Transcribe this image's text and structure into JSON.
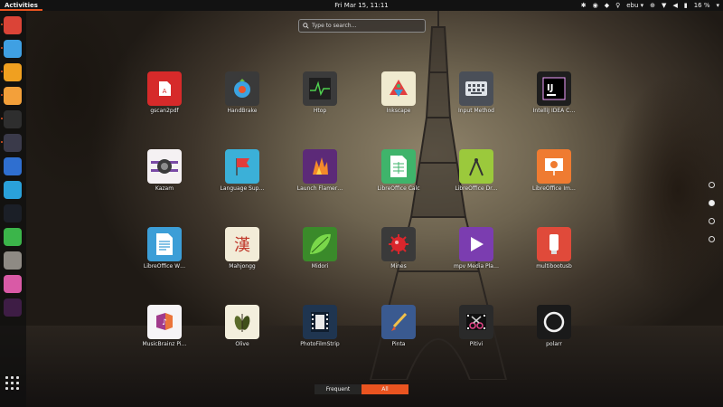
{
  "topbar": {
    "activities": "Activities",
    "clock": "Fri Mar 15, 11:11",
    "user": "ebu",
    "battery": "16 %"
  },
  "search": {
    "placeholder": "Type to search…"
  },
  "dock": [
    {
      "name": "chrome",
      "color": "#db4437"
    },
    {
      "name": "firefox",
      "color": "#3fa0e3"
    },
    {
      "name": "mail",
      "color": "#f0a020"
    },
    {
      "name": "screenshot",
      "color": "#f3a03a"
    },
    {
      "name": "terminal",
      "color": "#2e2e2e"
    },
    {
      "name": "obs",
      "color": "#3a3a4a"
    },
    {
      "name": "virtualbox",
      "color": "#2f6fd0"
    },
    {
      "name": "telegram",
      "color": "#2aa1da"
    },
    {
      "name": "steam",
      "color": "#1b1f27"
    },
    {
      "name": "downloader",
      "color": "#3bb54a"
    },
    {
      "name": "archiver",
      "color": "#8e8a84"
    },
    {
      "name": "headset",
      "color": "#d95aa6"
    },
    {
      "name": "slack",
      "color": "#3e1d45"
    }
  ],
  "apps": [
    {
      "label": "gscan2pdf",
      "color": "#d62a2a",
      "icon": "pdf-icon"
    },
    {
      "label": "HandBrake",
      "color": "#3a3a3a",
      "icon": "pineapple-icon"
    },
    {
      "label": "Htop",
      "color": "#3b3b3b",
      "icon": "pulse-icon"
    },
    {
      "label": "Inkscape",
      "color": "#f0eacf",
      "icon": "inkscape-icon"
    },
    {
      "label": "Input Method",
      "color": "#4a4f58",
      "icon": "keyboard-icon"
    },
    {
      "label": "IntelliJ IDEA C…",
      "color": "#1e1e1e",
      "icon": "intellij-icon"
    },
    {
      "label": "Kazam",
      "color": "#f5f1f3",
      "icon": "camera-icon"
    },
    {
      "label": "Language Sup…",
      "color": "#3bb0d8",
      "icon": "flag-icon"
    },
    {
      "label": "Launch Flamer…",
      "color": "#5c2a78",
      "icon": "flame-icon"
    },
    {
      "label": "LibreOffice Calc",
      "color": "#3fb46b",
      "icon": "spreadsheet-icon"
    },
    {
      "label": "LibreOffice Dr…",
      "color": "#9bc93c",
      "icon": "compass-icon"
    },
    {
      "label": "LibreOffice Im…",
      "color": "#ef7b31",
      "icon": "presentation-icon"
    },
    {
      "label": "LibreOffice W…",
      "color": "#3c9ed7",
      "icon": "document-icon"
    },
    {
      "label": "Mahjongg",
      "color": "#f2ecd8",
      "icon": "mahjongg-icon"
    },
    {
      "label": "Midori",
      "color": "#3a8a2a",
      "icon": "leaf-icon"
    },
    {
      "label": "Mines",
      "color": "#3a3a3a",
      "icon": "mine-icon"
    },
    {
      "label": "mpv Media Pla…",
      "color": "#7b3db0",
      "icon": "play-icon"
    },
    {
      "label": "multibootusb",
      "color": "#e04a3a",
      "icon": "usb-icon"
    },
    {
      "label": "MusicBrainz Pi…",
      "color": "#f6f4f7",
      "icon": "music-icon"
    },
    {
      "label": "Olive",
      "color": "#f3efdd",
      "icon": "olive-icon"
    },
    {
      "label": "PhotoFilmStrip",
      "color": "#1f3550",
      "icon": "filmstrip-icon"
    },
    {
      "label": "Pinta",
      "color": "#3a5a90",
      "icon": "brush-icon"
    },
    {
      "label": "Pitivi",
      "color": "#2a2a2a",
      "icon": "scissors-icon"
    },
    {
      "label": "polarr",
      "color": "#1a1a1a",
      "icon": "ring-icon"
    }
  ],
  "pager": {
    "count": 4,
    "active": 1
  },
  "switcher": {
    "frequent": "Frequent",
    "all": "All"
  },
  "colors": {
    "accent": "#e95420",
    "panel": "#121212"
  }
}
